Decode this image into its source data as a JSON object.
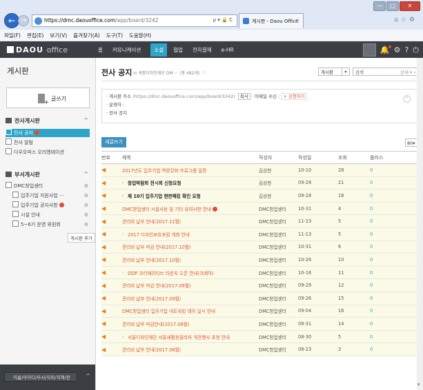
{
  "browser": {
    "url_host": "https://dmc.daouoffice.com",
    "url_path": "/app/board/3242",
    "url_controls": "⍴ ▾ 🔒 C",
    "tab_title": "게시판 - Daou Office",
    "menu": [
      "파일(F)",
      "편집(E)",
      "보기(V)",
      "즐겨찾기(A)",
      "도구(T)",
      "도움말(H)"
    ],
    "window_buttons": [
      "—",
      "□",
      "✕"
    ]
  },
  "app": {
    "logo": "DAOU",
    "logo_sub": "office",
    "nav": [
      "홈",
      "커뮤니케이션",
      "소셜",
      "협업",
      "전자결재",
      "e-HR"
    ],
    "nav_active_index": 2
  },
  "sidebar": {
    "title": "게시판",
    "write_label": "글쓰기",
    "section1": "전사게시판",
    "section1_items": [
      "전사 공지",
      "전사 알림",
      "다우오피스 오리엔테이션"
    ],
    "section2": "부서게시판",
    "dept": "DMC창업센터",
    "dept_items": [
      "입주기업 지원사업 ···",
      "입주기업 공지사항",
      "시설 안내",
      "5~6기 운영 위원회"
    ],
    "add_button": "게시판 추가",
    "search_placeholder": "이름/아이디/부서/직위/직책/전"
  },
  "main": {
    "title": "전사 공지",
    "subtitle": "in 세종디자인재단 DM ··· (총 482개)",
    "search_select": "게시판",
    "search_placeholder": "검색",
    "search_detail": "상세 ▾",
    "info": {
      "address_label": "· 게시판 주소",
      "address_value": "(https://dmc.daouoffice.com/app/board/3242)",
      "copy": "복사",
      "mail_label": "· 이메일 수신 :",
      "mail_btn": "+ 신청하기",
      "operator": "· 운영자 :",
      "desc": "· 전사 공지"
    },
    "new_button": "새글쓰기",
    "page_size": "80"
  },
  "table": {
    "headers": [
      "번호",
      "제목",
      "작성자",
      "작성일",
      "조회",
      "플러스"
    ],
    "rows": [
      {
        "title": "2017년도 입주기업 역량강화 프로그램 일정",
        "author": "김상현",
        "date": "10-10",
        "views": "28",
        "plus": "0",
        "notice": true,
        "bold": false,
        "reply": false,
        "new": false
      },
      {
        "title": "창업박람회 전시회 신청요청",
        "author": "김상현",
        "date": "09-28",
        "views": "21",
        "plus": "0",
        "notice": true,
        "bold": true,
        "reply": true,
        "new": false
      },
      {
        "title": "제 10기 입주기업 현판패킹 확인 요청",
        "author": "김상현",
        "date": "09-28",
        "views": "16",
        "plus": "0",
        "notice": true,
        "bold": true,
        "reply": true,
        "new": false
      },
      {
        "title": "DMC창업센터 시설사용 및 기타 유의사항 안내",
        "author": "DMC창업센터",
        "date": "10-31",
        "views": "4",
        "plus": "0",
        "notice": true,
        "bold": false,
        "reply": false,
        "new": true
      },
      {
        "title": "관리비 납부 안내(2017.11월)",
        "author": "DMC창업센터",
        "date": "11-23",
        "views": "5",
        "plus": "0",
        "notice": true,
        "bold": false,
        "reply": false,
        "new": false
      },
      {
        "title": "2017 디자인보호포럼 개최 안내",
        "author": "DMC창업센터",
        "date": "11-13",
        "views": "5",
        "plus": "0",
        "notice": true,
        "bold": false,
        "reply": true,
        "new": false
      },
      {
        "title": "관리비 납부 마감 안내(2017.10월)",
        "author": "DMC창업센터",
        "date": "10-31",
        "views": "6",
        "plus": "0",
        "notice": true,
        "bold": false,
        "reply": false,
        "new": false
      },
      {
        "title": "관리비 납부 안내(2017.10월)",
        "author": "DMC창업센터",
        "date": "10-26",
        "views": "10",
        "plus": "0",
        "notice": true,
        "bold": false,
        "reply": false,
        "new": false
      },
      {
        "title": "DDP 크리에이티브 라운지 오픈 안내(크레아)",
        "author": "DMC창업센터",
        "date": "10-16",
        "views": "11",
        "plus": "0",
        "notice": true,
        "bold": false,
        "reply": true,
        "new": false
      },
      {
        "title": "관리비 납부 마감 안내(2017.09월)",
        "author": "DMC창업센터",
        "date": "09-29",
        "views": "12",
        "plus": "0",
        "notice": true,
        "bold": false,
        "reply": false,
        "new": false
      },
      {
        "title": "관리비 납부 안내(2017.09월)",
        "author": "DMC창업센터",
        "date": "09-26",
        "views": "15",
        "plus": "0",
        "notice": true,
        "bold": false,
        "reply": false,
        "new": false
      },
      {
        "title": "DMC창업센터 입주기업 네트워킹 데이 실시 안내",
        "author": "DMC창업센터",
        "date": "09-04",
        "views": "16",
        "plus": "0",
        "notice": true,
        "bold": false,
        "reply": false,
        "new": false
      },
      {
        "title": "관리비 납부 마감안내(2017.08월)",
        "author": "DMC창업센터",
        "date": "08-31",
        "views": "14",
        "plus": "0",
        "notice": true,
        "bold": false,
        "reply": false,
        "new": false
      },
      {
        "title": "서울디자인재단 서울새활용플라자 개관행사 초청 안내",
        "author": "DMC창업센터",
        "date": "08-30",
        "views": "5",
        "plus": "0",
        "notice": true,
        "bold": false,
        "reply": true,
        "new": false
      },
      {
        "title": "관리비 납부 안내(2017.08월)",
        "author": "DMC창업센터",
        "date": "08-23",
        "views": "3",
        "plus": "0",
        "notice": true,
        "bold": false,
        "reply": false,
        "new": false
      }
    ]
  },
  "colors": {
    "accent": "#2da5c9",
    "header": "#3b3f44",
    "notice_bg": "#fbfae6",
    "title_red": "#d9542f"
  }
}
